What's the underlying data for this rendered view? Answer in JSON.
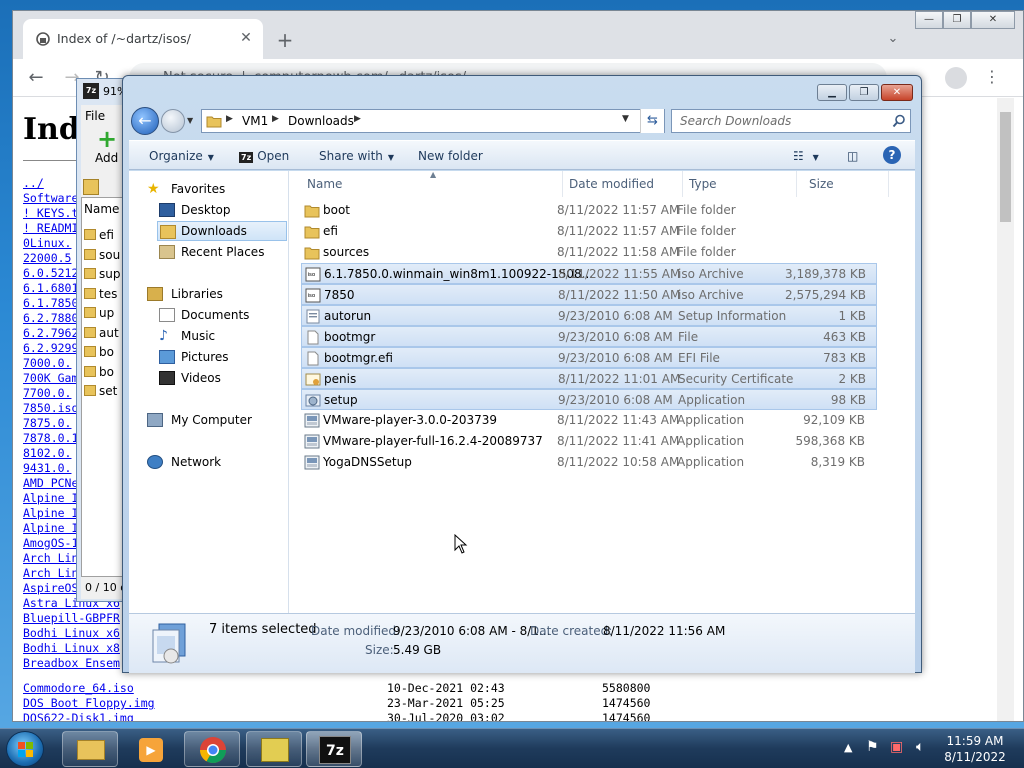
{
  "browser": {
    "tab_title": "Index of /~dartz/isos/",
    "url_security": "Not secure",
    "url": "computernewb.com/~dartz/isos/",
    "page_heading": "Index",
    "links": [
      "../",
      "Software",
      "! KEYS.t",
      "! READMI",
      "0Linux.",
      "22000.5",
      "6.0.5212",
      "6.1.6801",
      "6.1.7850",
      "6.2.7880",
      "6.2.7962",
      "6.2.9299",
      "7000.0.",
      "700K Gam",
      "7700.0.",
      "7850.iso",
      "7875.0.",
      "7878.0.1",
      "8102.0.",
      "9431.0.",
      "AMD PCNe",
      "Alpine I",
      "Alpine I",
      "Alpine I",
      "AmogOS-1",
      "Arch Lin",
      "Arch Lin",
      "AspireOS",
      "Astra Linux x6",
      "Bluepill-GBPFR",
      "Bodhi Linux x6",
      "Bodhi Linux x8",
      "Breadbox Ensem"
    ],
    "file_rows": [
      {
        "name": "Commodore_64.iso",
        "date": "10-Dec-2021 02:43",
        "size": "5580800"
      },
      {
        "name": "DOS Boot Floppy.img",
        "date": "23-Mar-2021 05:25",
        "size": "1474560"
      },
      {
        "name": "DOS622-Disk1.img",
        "date": "30-Jul-2020 03:02",
        "size": "1474560"
      }
    ]
  },
  "sevenzip": {
    "title": "91%",
    "menu_file": "File",
    "add_label": "Add",
    "col_name": "Name",
    "rows": [
      "efi",
      "sou",
      "sup",
      "tes",
      "up",
      "aut",
      "bo",
      "bo",
      "set"
    ],
    "status": "0 / 10 o"
  },
  "explorer": {
    "address": [
      "VM1",
      "Downloads"
    ],
    "search_placeholder": "Search Downloads",
    "commands": {
      "organize": "Organize",
      "open": "Open",
      "share_with": "Share with",
      "new_folder": "New folder"
    },
    "nav": {
      "favorites": "Favorites",
      "favorites_items": [
        "Desktop",
        "Downloads",
        "Recent Places"
      ],
      "libraries": "Libraries",
      "libraries_items": [
        "Documents",
        "Music",
        "Pictures",
        "Videos"
      ],
      "computer": "My Computer",
      "network": "Network"
    },
    "columns": {
      "name": "Name",
      "date": "Date modified",
      "type": "Type",
      "size": "Size"
    },
    "files": [
      {
        "name": "boot",
        "date": "8/11/2022 11:57 AM",
        "type": "File folder",
        "size": "",
        "icon": "folder-icon",
        "selected": false
      },
      {
        "name": "efi",
        "date": "8/11/2022 11:57 AM",
        "type": "File folder",
        "size": "",
        "icon": "folder-icon",
        "selected": false
      },
      {
        "name": "sources",
        "date": "8/11/2022 11:58 AM",
        "type": "File folder",
        "size": "",
        "icon": "folder-icon",
        "selected": false
      },
      {
        "name": "6.1.7850.0.winmain_win8m1.100922-1508...",
        "date": "8/11/2022 11:55 AM",
        "type": "iso Archive",
        "size": "3,189,378 KB",
        "icon": "iso-icon",
        "selected": true
      },
      {
        "name": "7850",
        "date": "8/11/2022 11:50 AM",
        "type": "iso Archive",
        "size": "2,575,294 KB",
        "icon": "iso-icon",
        "selected": true
      },
      {
        "name": "autorun",
        "date": "9/23/2010 6:08 AM",
        "type": "Setup Information",
        "size": "1 KB",
        "icon": "inf-icon",
        "selected": true
      },
      {
        "name": "bootmgr",
        "date": "9/23/2010 6:08 AM",
        "type": "File",
        "size": "463 KB",
        "icon": "file-icon",
        "selected": true
      },
      {
        "name": "bootmgr.efi",
        "date": "9/23/2010 6:08 AM",
        "type": "EFI File",
        "size": "783 KB",
        "icon": "file-icon",
        "selected": true
      },
      {
        "name": "penis",
        "date": "8/11/2022 11:01 AM",
        "type": "Security Certificate",
        "size": "2 KB",
        "icon": "certificate-icon",
        "selected": true
      },
      {
        "name": "setup",
        "date": "9/23/2010 6:08 AM",
        "type": "Application",
        "size": "98 KB",
        "icon": "setup-icon",
        "selected": true
      },
      {
        "name": "VMware-player-3.0.0-203739",
        "date": "8/11/2022 11:43 AM",
        "type": "Application",
        "size": "92,109 KB",
        "icon": "installer-icon",
        "selected": false
      },
      {
        "name": "VMware-player-full-16.2.4-20089737",
        "date": "8/11/2022 11:41 AM",
        "type": "Application",
        "size": "598,368 KB",
        "icon": "installer-icon",
        "selected": false
      },
      {
        "name": "YogaDNSSetup",
        "date": "8/11/2022 10:58 AM",
        "type": "Application",
        "size": "8,319 KB",
        "icon": "installer-icon",
        "selected": false
      }
    ],
    "details": {
      "count": "7 items selected",
      "modified_label": "Date modified:",
      "modified_value": "9/23/2010 6:08 AM - 8/1...",
      "created_label": "Date created:",
      "created_value": "8/11/2022 11:56 AM",
      "size_label": "Size:",
      "size_value": "5.49 GB"
    }
  },
  "taskbar": {
    "time": "11:59 AM",
    "date": "8/11/2022",
    "sevenzip_label": "7z"
  }
}
